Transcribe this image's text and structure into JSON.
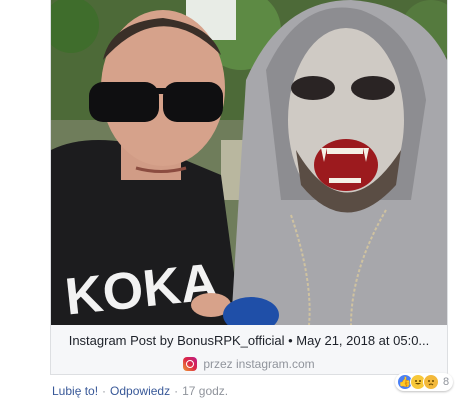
{
  "post": {
    "caption": "Instagram Post by BonusRPK_official • May 21, 2018 at 05:0...",
    "source_text": "przez instagram.com",
    "photo_text": "KOKA"
  },
  "comment_actions": {
    "like_label": "Lubię to!",
    "separator": "·",
    "reply_label": "Odpowiedz",
    "time_label": "17 godz."
  },
  "reactions": {
    "count": "8",
    "types": [
      "like-icon",
      "haha-icon",
      "sad-icon"
    ]
  },
  "colors": {
    "link": "#385898",
    "muted": "#90949c",
    "like_blue": "#4a80f5",
    "emoji_yellow": "#f7c83a"
  }
}
